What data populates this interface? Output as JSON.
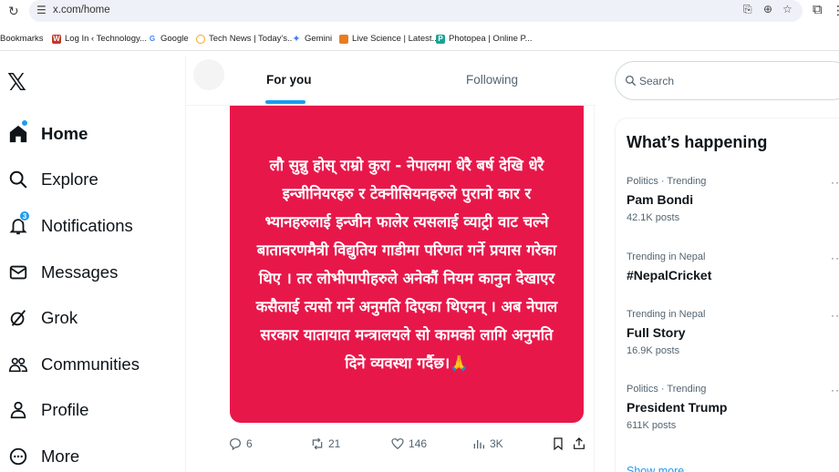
{
  "browser": {
    "url": "x.com/home",
    "bookmarks": [
      {
        "label": "Bookmarks",
        "icon": "bookmarks-folder-icon"
      },
      {
        "label": "Log In ‹ Technology...",
        "icon": "wordpress-icon",
        "color": "#c0392b"
      },
      {
        "label": "Google",
        "icon": "google-icon",
        "color": "#4285f4"
      },
      {
        "label": "Tech News | Today's...",
        "icon": "tech-news-icon",
        "color": "#f5a623"
      },
      {
        "label": "Gemini",
        "icon": "gemini-icon",
        "color": "#4a7cf7"
      },
      {
        "label": "Live Science | Latest...",
        "icon": "live-science-icon",
        "color": "#e67e22"
      },
      {
        "label": "Photopea | Online P...",
        "icon": "photopea-icon",
        "color": "#18a497"
      }
    ]
  },
  "nav": {
    "logo": "𝕏",
    "items": [
      {
        "label": "Home",
        "icon": "home-icon",
        "active": true
      },
      {
        "label": "Explore",
        "icon": "search-icon"
      },
      {
        "label": "Notifications",
        "icon": "bell-icon",
        "badge": "3"
      },
      {
        "label": "Messages",
        "icon": "envelope-icon"
      },
      {
        "label": "Grok",
        "icon": "grok-icon"
      },
      {
        "label": "Communities",
        "icon": "communities-icon"
      },
      {
        "label": "Profile",
        "icon": "person-icon"
      },
      {
        "label": "More",
        "icon": "more-circle-icon"
      }
    ]
  },
  "feed": {
    "tabs": [
      {
        "label": "For you",
        "active": true
      },
      {
        "label": "Following",
        "active": false
      }
    ],
    "post": {
      "image_text": "लौ सुन्नु होस् राम्रो कुरा - नेपालमा धेरै बर्ष देखि धेरै इन्जीनियरहरु र टेक्नीसियनहरुले पुरानो कार र भ्यानहरुलाई इन्जीन फालेर त्यसलाई व्याट्री वाट चल्ने बातावरणमैत्री विद्युतिय गाडीमा परिणत गर्ने प्रयास गरेका थिए । तर लोभीपापीहरुले अनेकौं नियम कानुन देखाएर कसैलाई त्यसो गर्ने अनुमति दिएका थिएनन् । अब नेपाल सरकार यातायात मन्त्रालयले सो कामको लागि अनुमति दिने व्यवस्था गर्दैछ।🙏",
      "image_color": "#e8174a",
      "replies": "6",
      "reposts": "21",
      "likes": "146",
      "views": "3K"
    }
  },
  "sidebar": {
    "search_placeholder": "Search",
    "trends_title": "What’s happening",
    "trends": [
      {
        "meta": "Politics · Trending",
        "name": "Pam Bondi",
        "count": "42.1K posts"
      },
      {
        "meta": "Trending in Nepal",
        "name": "#NepalCricket",
        "count": ""
      },
      {
        "meta": "Trending in Nepal",
        "name": "Full Story",
        "count": "16.9K posts"
      },
      {
        "meta": "Politics · Trending",
        "name": "President Trump",
        "count": "611K posts"
      }
    ],
    "show_more": "Show more"
  },
  "colors": {
    "accent": "#1d9bf0",
    "text": "#0f1419",
    "muted": "#536471"
  }
}
